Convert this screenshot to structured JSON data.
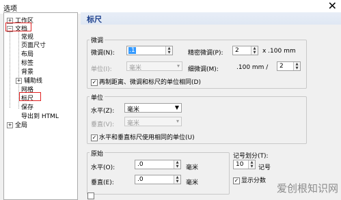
{
  "window": {
    "title": "选项",
    "close_glyph": "✕"
  },
  "tree": {
    "items": [
      {
        "label": "工作区",
        "expander": "+"
      },
      {
        "label": "文档",
        "expander": "−"
      },
      {
        "label": "常规"
      },
      {
        "label": "页面尺寸"
      },
      {
        "label": "布局"
      },
      {
        "label": "标签"
      },
      {
        "label": "背景"
      },
      {
        "label": "辅助线",
        "expander": "+"
      },
      {
        "label": "网格"
      },
      {
        "label": "标尺"
      },
      {
        "label": "保存"
      },
      {
        "label": "导出到 HTML"
      },
      {
        "label": "全局",
        "expander": "+"
      }
    ],
    "highlight_color": "#e02020"
  },
  "panel": {
    "title": "标尺",
    "nudge": {
      "group": "微调",
      "nudge_label": "微调(N):",
      "nudge_value": ".1",
      "super_label": "精密微调(P):",
      "super_value": "2",
      "super_suffix": "x .100 mm",
      "unit_label": "单位(I):",
      "unit_value": "毫米",
      "micro_label": "细微调(M):",
      "micro_prefix": ".100 mm /",
      "micro_value": "2",
      "same_units": "再制距离、微调和标尺的单位相同(D)"
    },
    "units": {
      "group": "单位",
      "h_label": "水平(Z):",
      "h_value": "毫米",
      "v_label": "垂直(V):",
      "v_value": "毫米",
      "same_units": "水平和垂直标尺使用相同的单位(U)"
    },
    "origin": {
      "group": "原始",
      "h_label": "水平(O):",
      "h_value": ".0",
      "h_unit": "毫米",
      "v_label": "垂直(E):",
      "v_value": ".0",
      "v_unit": "毫米"
    },
    "ticks": {
      "label": "记号划分(T):",
      "value": "10",
      "unit": "记号",
      "show_fractions": "显示分数"
    }
  },
  "watermark": "爱创根知识网",
  "colors": {
    "accent": "#1c3f8c",
    "selection": "#3399ff"
  }
}
